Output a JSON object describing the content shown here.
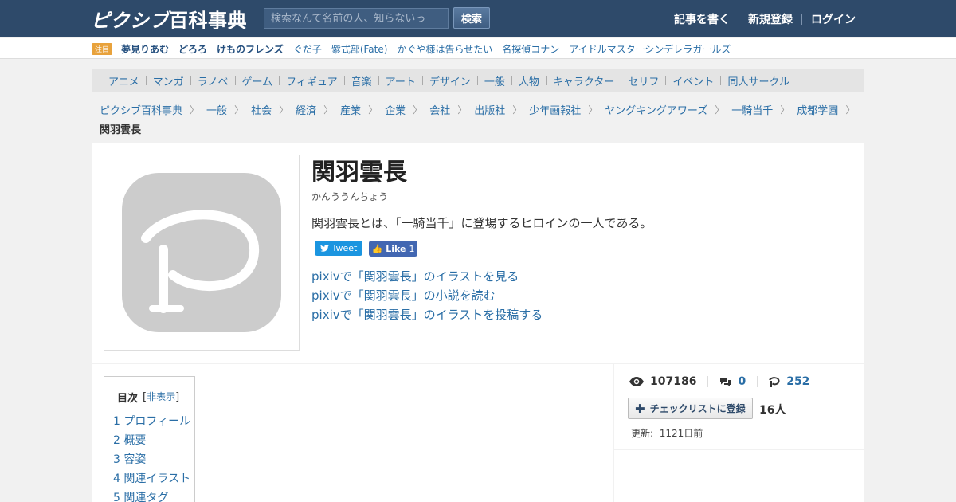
{
  "header": {
    "logo_kana": "ピクシブ",
    "logo_kanji": "百科事典",
    "search_placeholder": "検索なんて名前の人、知らないっ",
    "search_button": "検索",
    "links": [
      "記事を書く",
      "新規登録",
      "ログイン"
    ]
  },
  "trending": {
    "badge": "注目",
    "items": [
      {
        "label": "夢見りあむ",
        "bold": true
      },
      {
        "label": "どろろ",
        "bold": true
      },
      {
        "label": "けものフレンズ",
        "bold": true
      },
      {
        "label": "ぐだ子",
        "bold": false
      },
      {
        "label": "紫式部(Fate)",
        "bold": false
      },
      {
        "label": "かぐや様は告らせたい",
        "bold": false
      },
      {
        "label": "名探偵コナン",
        "bold": false
      },
      {
        "label": "アイドルマスターシンデレラガールズ",
        "bold": false
      }
    ]
  },
  "categories": [
    "アニメ",
    "マンガ",
    "ラノベ",
    "ゲーム",
    "フィギュア",
    "音楽",
    "アート",
    "デザイン",
    "一般",
    "人物",
    "キャラクター",
    "セリフ",
    "イベント",
    "同人サークル"
  ],
  "breadcrumb": {
    "items": [
      "ピクシブ百科事典",
      "一般",
      "社会",
      "経済",
      "産業",
      "企業",
      "会社",
      "出版社",
      "少年画報社",
      "ヤングキングアワーズ",
      "一騎当千",
      "成都学園"
    ],
    "current": "関羽雲長"
  },
  "article": {
    "title": "関羽雲長",
    "reading": "かんううんちょう",
    "description": "関羽雲長とは、「一騎当千」に登場するヒロインの一人である。",
    "tweet_label": "Tweet",
    "like_label": "Like",
    "like_count": "1",
    "links": [
      "pixivで「関羽雲長」のイラストを見る",
      "pixivで「関羽雲長」の小説を読む",
      "pixivで「関羽雲長」のイラストを投稿する"
    ]
  },
  "toc": {
    "title": "目次",
    "hide_label": "非表示",
    "items": [
      "1 プロフィール",
      "2 概要",
      "3 容姿",
      "4 関連イラスト",
      "5 関連タグ"
    ]
  },
  "stats": {
    "views": "107186",
    "comments": "0",
    "pixiv_works": "252",
    "checklist_label": "チェックリストに登録",
    "checklist_count": "16人",
    "updated_label": "更新:",
    "updated_value": "1121日前"
  },
  "colors": {
    "header_bg": "#2e4a6a",
    "link": "#2a6ea6",
    "badge": "#e8a23c",
    "tweet": "#1b95e0",
    "like": "#4267b2"
  }
}
